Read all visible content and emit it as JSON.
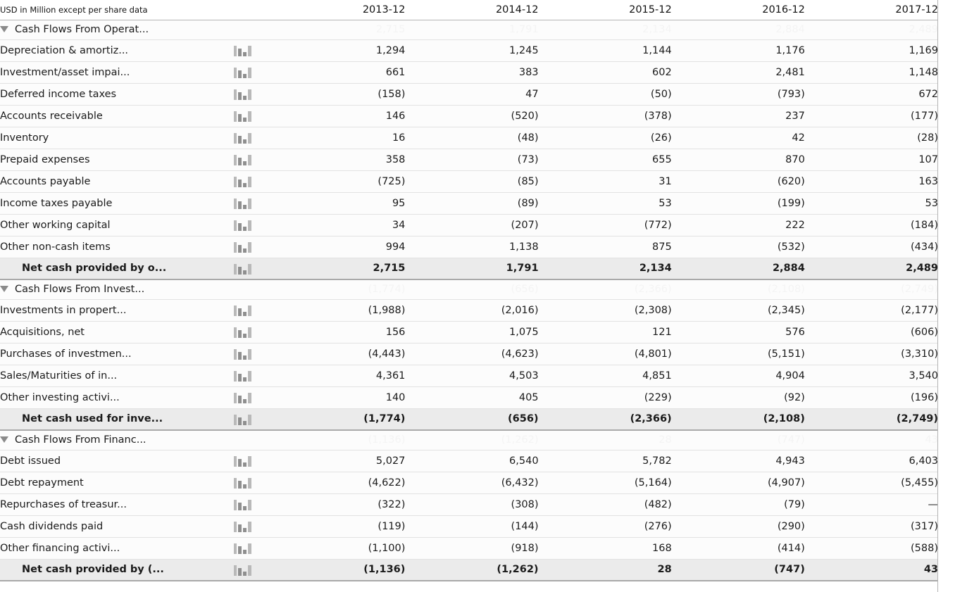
{
  "header": {
    "unit_label": "USD in Million except per share data",
    "periods": [
      "2013-12",
      "2014-12",
      "2015-12",
      "2016-12",
      "2017-12"
    ]
  },
  "icons": {
    "sparkline": "bar-chart-icon",
    "expand_toggle": "caret-down-icon"
  },
  "colors": {
    "total_row_background": "#ebebeb",
    "row_background": "#fcfcfc",
    "row_divider": "#e2e2e2",
    "header_divider": "#b4b4b4",
    "total_row_border": "#a9a9a9",
    "spark_bar_light": "#b9b9b9",
    "spark_bar_dark": "#8f8f8f",
    "text": "#1a1a1a",
    "ghost_text": "#f4f4f4"
  },
  "sections": [
    {
      "title": "Cash Flows From Operat...",
      "ghost_values": [
        "2,715",
        "1,791",
        "2,134",
        "2,884",
        "2,489"
      ],
      "rows": [
        {
          "label": "Depreciation & amortiz...",
          "values": [
            "1,294",
            "1,245",
            "1,144",
            "1,176",
            "1,169"
          ]
        },
        {
          "label": "Investment/asset impai...",
          "values": [
            "661",
            "383",
            "602",
            "2,481",
            "1,148"
          ]
        },
        {
          "label": "Deferred income taxes",
          "values": [
            "(158)",
            "47",
            "(50)",
            "(793)",
            "672"
          ]
        },
        {
          "label": "Accounts receivable",
          "values": [
            "146",
            "(520)",
            "(378)",
            "237",
            "(177)"
          ]
        },
        {
          "label": "Inventory",
          "values": [
            "16",
            "(48)",
            "(26)",
            "42",
            "(28)"
          ]
        },
        {
          "label": "Prepaid expenses",
          "values": [
            "358",
            "(73)",
            "655",
            "870",
            "107"
          ]
        },
        {
          "label": "Accounts payable",
          "values": [
            "(725)",
            "(85)",
            "31",
            "(620)",
            "163"
          ]
        },
        {
          "label": "Income taxes payable",
          "values": [
            "95",
            "(89)",
            "53",
            "(199)",
            "53"
          ]
        },
        {
          "label": "Other working capital",
          "values": [
            "34",
            "(207)",
            "(772)",
            "222",
            "(184)"
          ]
        },
        {
          "label": "Other non-cash items",
          "values": [
            "994",
            "1,138",
            "875",
            "(532)",
            "(434)"
          ]
        }
      ],
      "total": {
        "label": "Net cash provided by o...",
        "values": [
          "2,715",
          "1,791",
          "2,134",
          "2,884",
          "2,489"
        ]
      }
    },
    {
      "title": "Cash Flows From Invest...",
      "ghost_values": [
        "(1,774)",
        "(656)",
        "(2,366)",
        "(2,108)",
        "(2,749)"
      ],
      "rows": [
        {
          "label": "Investments in propert...",
          "values": [
            "(1,988)",
            "(2,016)",
            "(2,308)",
            "(2,345)",
            "(2,177)"
          ]
        },
        {
          "label": "Acquisitions, net",
          "values": [
            "156",
            "1,075",
            "121",
            "576",
            "(606)"
          ]
        },
        {
          "label": "Purchases of investmen...",
          "values": [
            "(4,443)",
            "(4,623)",
            "(4,801)",
            "(5,151)",
            "(3,310)"
          ]
        },
        {
          "label": "Sales/Maturities of in...",
          "values": [
            "4,361",
            "4,503",
            "4,851",
            "4,904",
            "3,540"
          ]
        },
        {
          "label": "Other investing activi...",
          "values": [
            "140",
            "405",
            "(229)",
            "(92)",
            "(196)"
          ]
        }
      ],
      "total": {
        "label": "Net cash used for inve...",
        "values": [
          "(1,774)",
          "(656)",
          "(2,366)",
          "(2,108)",
          "(2,749)"
        ]
      }
    },
    {
      "title": "Cash Flows From Financ...",
      "ghost_values": [
        "(1,136)",
        "(1,262)",
        "28",
        "(747)",
        "43"
      ],
      "rows": [
        {
          "label": "Debt issued",
          "values": [
            "5,027",
            "6,540",
            "5,782",
            "4,943",
            "6,403"
          ]
        },
        {
          "label": "Debt repayment",
          "values": [
            "(4,622)",
            "(6,432)",
            "(5,164)",
            "(4,907)",
            "(5,455)"
          ]
        },
        {
          "label": "Repurchases of treasur...",
          "values": [
            "(322)",
            "(308)",
            "(482)",
            "(79)",
            "—"
          ]
        },
        {
          "label": "Cash dividends paid",
          "values": [
            "(119)",
            "(144)",
            "(276)",
            "(290)",
            "(317)"
          ]
        },
        {
          "label": "Other financing activi...",
          "values": [
            "(1,100)",
            "(918)",
            "168",
            "(414)",
            "(588)"
          ]
        }
      ],
      "total": {
        "label": "Net cash provided by (...",
        "values": [
          "(1,136)",
          "(1,262)",
          "28",
          "(747)",
          "43"
        ]
      }
    }
  ]
}
